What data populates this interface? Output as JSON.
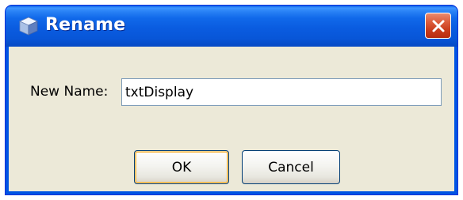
{
  "dialog": {
    "title": "Rename",
    "icon": "cube-icon",
    "close_icon": "close-icon"
  },
  "form": {
    "label": "New Name:",
    "value": "txtDisplay"
  },
  "buttons": {
    "ok": "OK",
    "cancel": "Cancel"
  },
  "colors": {
    "titlebar": "#0a5ce0",
    "client_bg": "#ece9d8",
    "close_button": "#dc5d3c",
    "default_button_highlight": "#f8b33c",
    "input_border": "#7f9db9"
  }
}
